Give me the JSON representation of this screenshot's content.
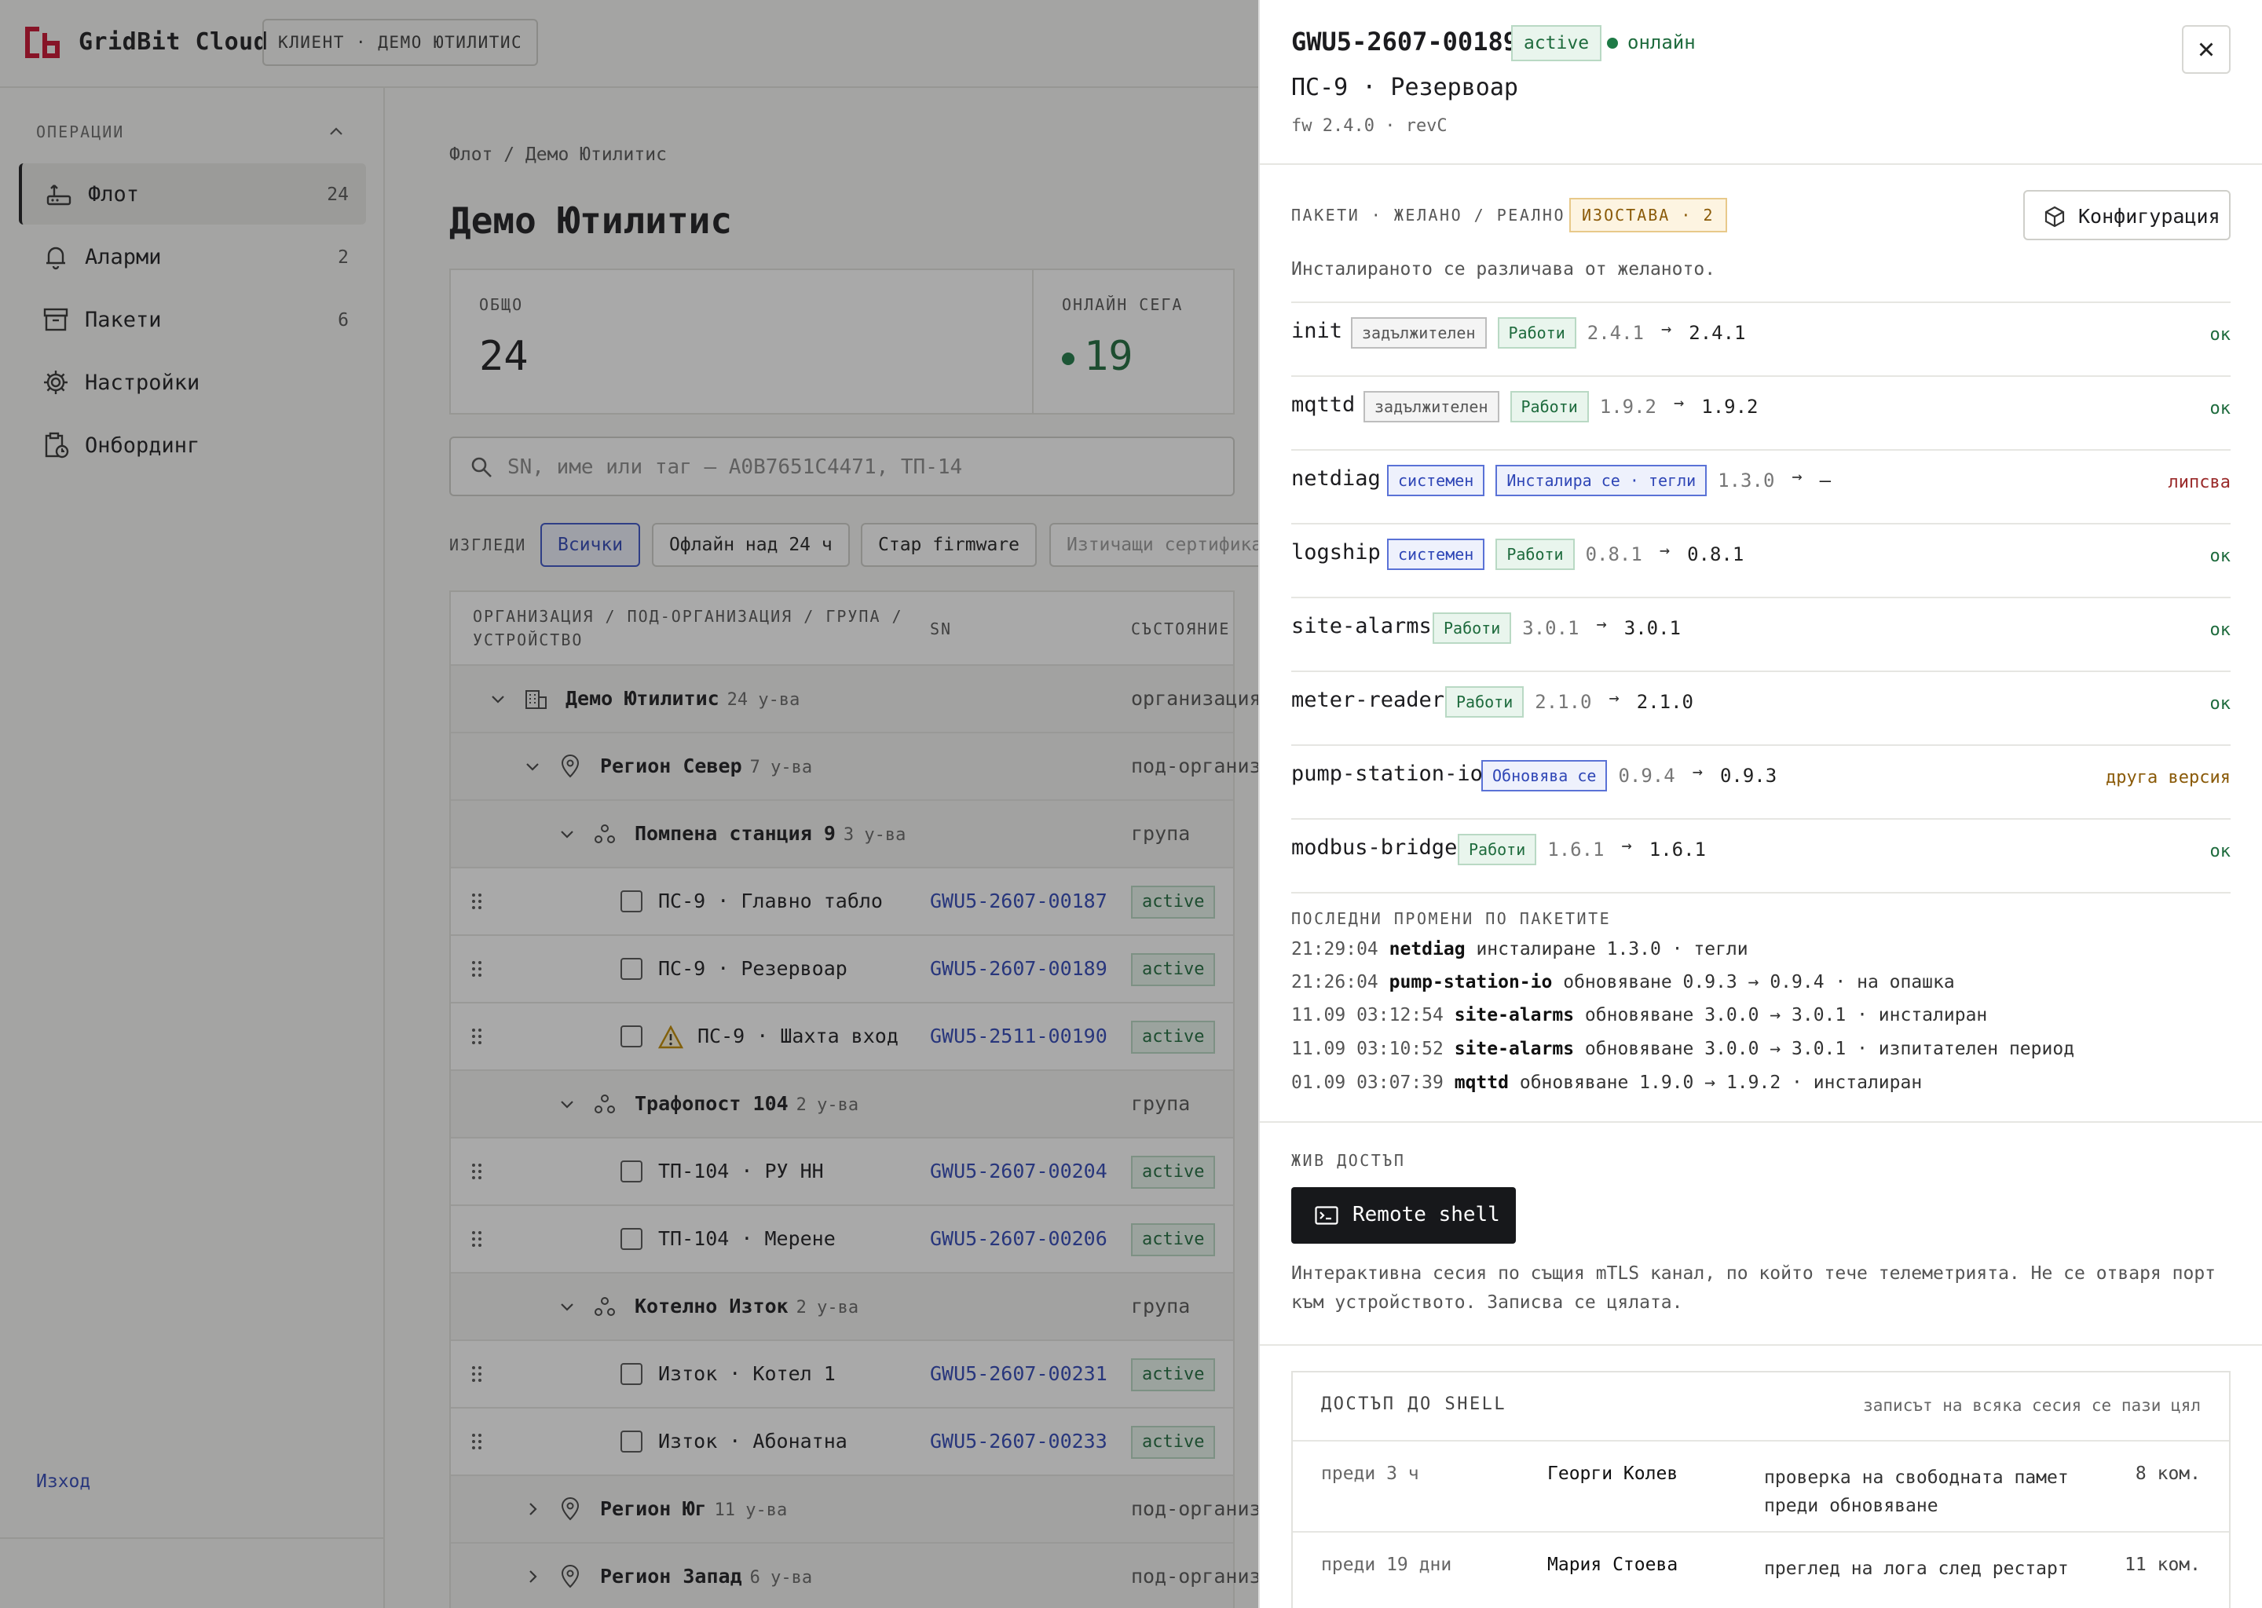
{
  "app": {
    "brand": "GridBit Cloud",
    "client_badge": "КЛИЕНТ · ДЕМО ЮТИЛИТИС",
    "colors": {
      "accent": "#2f46b6",
      "brand": "#c8102e",
      "ok": "#1e6b3d",
      "drift": "#8a5a08",
      "missing": "#9a2a2a"
    }
  },
  "sidebar": {
    "section": "ОПЕРАЦИИ",
    "items": [
      {
        "label": "Флот",
        "count": "24",
        "icon": "router-icon"
      },
      {
        "label": "Аларми",
        "count": "2",
        "icon": "bell-icon"
      },
      {
        "label": "Пакети",
        "count": "6",
        "icon": "archive-icon"
      },
      {
        "label": "Настройки",
        "count": "",
        "icon": "gear-icon"
      },
      {
        "label": "Онбординг",
        "count": "",
        "icon": "clipboard-icon"
      }
    ],
    "logout": "Изход"
  },
  "main": {
    "breadcrumb": "Флот / Демо Ютилитис",
    "title": "Демо Ютилитис",
    "stats": [
      {
        "label": "ОБЩО",
        "value": "24"
      },
      {
        "label": "ОНЛАЙН СЕГА",
        "value": "19"
      }
    ],
    "search_placeholder": "SN, име или таг — A0B7651C4471, ТП-14",
    "views_label": "ИЗГЛЕДИ",
    "views": [
      "Всички",
      "Офлайн над 24 ч",
      "Стар firmware",
      "Изтичащи сертифика"
    ],
    "columns": {
      "hierarchy": "ОРГАНИЗАЦИЯ / ПОД-ОРГАНИЗАЦИЯ / ГРУПА / УСТРОЙСТВО",
      "sn": "SN",
      "status": "СЪСТОЯНИЕ"
    },
    "rows": [
      {
        "kind": "org",
        "name": "Демо Ютилитис",
        "count": "24 у-ва",
        "type": "организация"
      },
      {
        "kind": "suborg",
        "name": "Регион Север",
        "count": "7 у-ва",
        "type": "под-организ"
      },
      {
        "kind": "group",
        "name": "Помпена станция 9",
        "count": "3 у-ва",
        "type": "група"
      },
      {
        "kind": "device",
        "name": "ПС-9 · Главно табло",
        "sn": "GWU5-2607-00187",
        "status": "active"
      },
      {
        "kind": "device",
        "name": "ПС-9 · Резервоар",
        "sn": "GWU5-2607-00189",
        "status": "active"
      },
      {
        "kind": "device",
        "name": "ПС-9 · Шахта вход",
        "sn": "GWU5-2511-00190",
        "status": "active",
        "warn": true
      },
      {
        "kind": "group",
        "name": "Трафопост 104",
        "count": "2 у-ва",
        "type": "група"
      },
      {
        "kind": "device",
        "name": "ТП-104 · РУ НН",
        "sn": "GWU5-2607-00204",
        "status": "active"
      },
      {
        "kind": "device",
        "name": "ТП-104 · Мерене",
        "sn": "GWU5-2607-00206",
        "status": "active"
      },
      {
        "kind": "group",
        "name": "Котелно Изток",
        "count": "2 у-ва",
        "type": "група"
      },
      {
        "kind": "device",
        "name": "Изток · Котел 1",
        "sn": "GWU5-2607-00231",
        "status": "active"
      },
      {
        "kind": "device",
        "name": "Изток · Абонатна",
        "sn": "GWU5-2607-00233",
        "status": "active"
      },
      {
        "kind": "suborg",
        "name": "Регион Юг",
        "count": "11 у-ва",
        "type": "под-организ",
        "collapsed": true
      },
      {
        "kind": "suborg",
        "name": "Регион Запад",
        "count": "6 у-ва",
        "type": "под-организ",
        "collapsed": true
      }
    ]
  },
  "drawer": {
    "sn": "GWU5-2607-00189",
    "status": "active",
    "online": "онлайн",
    "name": "ПС-9 · Резервоар",
    "fw": "fw 2.4.0 · revC",
    "packages_label": "ПАКЕТИ · ЖЕЛАНО / РЕАЛНО",
    "drift_badge": "ИЗОСТАВА · 2",
    "config_button": "Конфигурация",
    "packages_note": "Инсталираното се различава от желаното.",
    "packages": [
      {
        "name": "init",
        "tags": [
          {
            "label": "задължителен",
            "kind": "req"
          },
          {
            "label": "Работи",
            "kind": "run"
          }
        ],
        "desired": "2.4.1",
        "actual": "2.4.1",
        "state": "ок",
        "state_kind": "ok"
      },
      {
        "name": "mqttd",
        "tags": [
          {
            "label": "задължителен",
            "kind": "req"
          },
          {
            "label": "Работи",
            "kind": "run"
          }
        ],
        "desired": "1.9.2",
        "actual": "1.9.2",
        "state": "ок",
        "state_kind": "ok"
      },
      {
        "name": "netdiag",
        "tags": [
          {
            "label": "системен",
            "kind": "sys"
          },
          {
            "label": "Инсталира се · тегли",
            "kind": "inst"
          }
        ],
        "desired": "1.3.0",
        "actual": "—",
        "state": "липсва",
        "state_kind": "missing"
      },
      {
        "name": "logship",
        "tags": [
          {
            "label": "системен",
            "kind": "sys"
          },
          {
            "label": "Работи",
            "kind": "run"
          }
        ],
        "desired": "0.8.1",
        "actual": "0.8.1",
        "state": "ок",
        "state_kind": "ok"
      },
      {
        "name": "site-alarms",
        "tags": [
          {
            "label": "Работи",
            "kind": "run"
          }
        ],
        "desired": "3.0.1",
        "actual": "3.0.1",
        "state": "ок",
        "state_kind": "ok"
      },
      {
        "name": "meter-reader",
        "tags": [
          {
            "label": "Работи",
            "kind": "run"
          }
        ],
        "desired": "2.1.0",
        "actual": "2.1.0",
        "state": "ок",
        "state_kind": "ok"
      },
      {
        "name": "pump-station-io",
        "tags": [
          {
            "label": "Обновява се",
            "kind": "upd"
          }
        ],
        "desired": "0.9.4",
        "actual": "0.9.3",
        "state": "друга версия",
        "state_kind": "other"
      },
      {
        "name": "modbus-bridge",
        "tags": [
          {
            "label": "Работи",
            "kind": "run"
          }
        ],
        "desired": "1.6.1",
        "actual": "1.6.1",
        "state": "ок",
        "state_kind": "ok"
      }
    ],
    "changes_label": "ПОСЛЕДНИ ПРОМЕНИ ПО ПАКЕТИТЕ",
    "changes": [
      {
        "time": "21:29:04",
        "pkg": "netdiag",
        "text": "инсталиране 1.3.0 · тегли"
      },
      {
        "time": "21:26:04",
        "pkg": "pump-station-io",
        "text": "обновяване 0.9.3 → 0.9.4 · на опашка"
      },
      {
        "time": "11.09 03:12:54",
        "pkg": "site-alarms",
        "text": "обновяване 3.0.0 → 3.0.1 · инсталиран"
      },
      {
        "time": "11.09 03:10:52",
        "pkg": "site-alarms",
        "text": "обновяване 3.0.0 → 3.0.1 · изпитателен период"
      },
      {
        "time": "01.09 03:07:39",
        "pkg": "mqttd",
        "text": "обновяване 1.9.0 → 1.9.2 · инсталиран"
      }
    ],
    "live_label": "ЖИВ ДОСТЪП",
    "shell_button": "Remote shell",
    "shell_note": "Интерактивна сесия по същия mTLS канал, по който тече телеметрията. Не се отваря порт към устройството. Записва се цялата.",
    "access": {
      "title": "ДОСТЪП ДО SHELL",
      "note": "записът на всяка сесия се пази цял",
      "rows": [
        {
          "when": "преди 3 ч",
          "who": "Георги Колев",
          "what": "проверка на свободната памет преди обновяване",
          "cmds": "8 ком."
        },
        {
          "when": "преди 19 дни",
          "who": "Мария Стоева",
          "what": "преглед на лога след рестарт",
          "cmds": "11 ком."
        }
      ]
    }
  }
}
